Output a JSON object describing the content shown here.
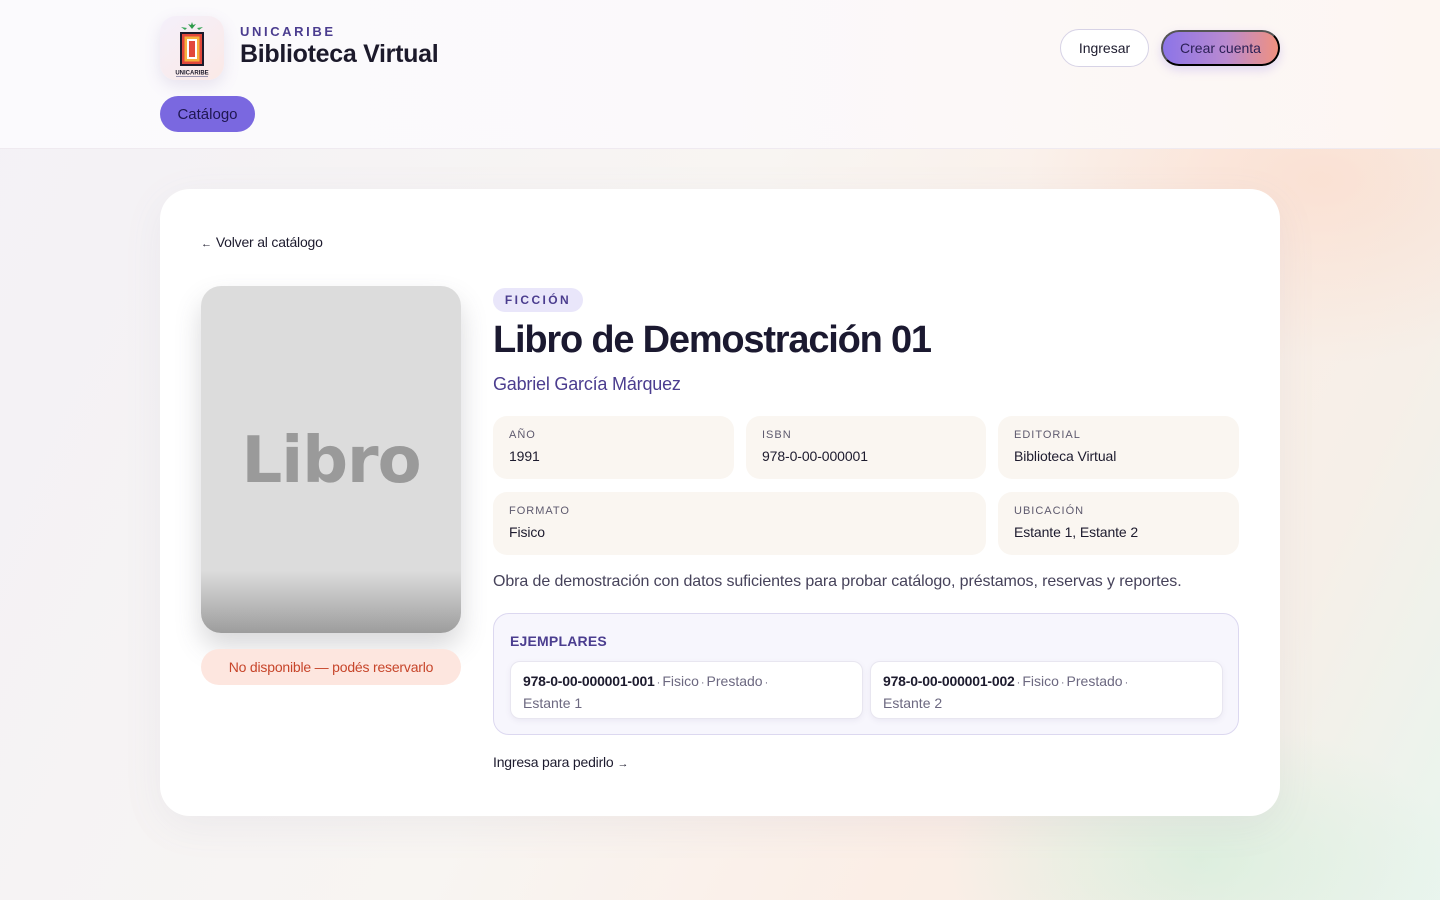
{
  "header": {
    "brand_sub": "UNICARIBE",
    "brand_title": "Biblioteca Virtual",
    "logo_text": "UNICARIBE",
    "login_label": "Ingresar",
    "signup_label": "Crear cuenta",
    "nav_catalog_label": "Catálogo"
  },
  "detail": {
    "back_label": "Volver al catálogo",
    "back_arrow": "←",
    "cover_text": "Libro",
    "availability": "No disponible — podés reservarlo",
    "genre": "FICCIÓN",
    "title": "Libro de Demostración 01",
    "author": "Gabriel García Márquez",
    "meta": {
      "year": {
        "label": "Año",
        "value": "1991"
      },
      "isbn": {
        "label": "ISBN",
        "value": "978-0-00-000001"
      },
      "publisher": {
        "label": "Editorial",
        "value": "Biblioteca Virtual"
      },
      "format": {
        "label": "Formato",
        "value": "Fisico"
      },
      "location": {
        "label": "Ubicación",
        "value": "Estante 1, Estante 2"
      }
    },
    "description": "Obra de demostración con datos suficientes para probar catálogo, préstamos, reservas y reportes.",
    "copies_title": "EJEMPLARES",
    "copies": [
      {
        "code": "978-0-00-000001-001",
        "format": "Fisico",
        "status": "Prestado",
        "location": "Estante 1"
      },
      {
        "code": "978-0-00-000001-002",
        "format": "Fisico",
        "status": "Prestado",
        "location": "Estante 2"
      }
    ],
    "request_label": "Ingresa para pedirlo",
    "request_arrow": "→"
  },
  "colors": {
    "accent": "#7a68e0",
    "brand_text": "#4b3d8f",
    "unavailable_bg": "#fde6df",
    "unavailable_text": "#c7452a"
  }
}
